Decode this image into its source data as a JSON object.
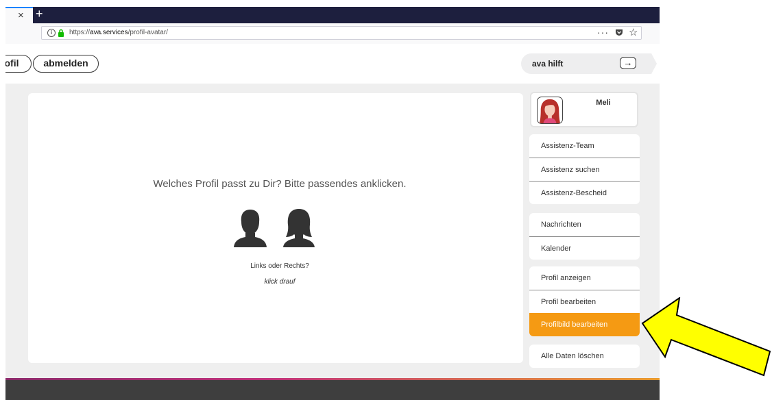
{
  "browser": {
    "tab_close": "×",
    "tab_new": "+",
    "url_prefix": "https://",
    "url_host": "ava.services",
    "url_path": "/profil-avatar/",
    "more_label": "···",
    "star_label": "☆"
  },
  "header": {
    "profil_button": "ofil",
    "logout_button": "abmelden",
    "help_label": "ava hilft",
    "help_arrow": "→"
  },
  "card": {
    "question": "Welches Profil passt zu Dir? Bitte passendes anklicken.",
    "hint": "Links oder Rechts?",
    "sub": "klick drauf"
  },
  "profile": {
    "name": "Meli"
  },
  "menu": {
    "group1": [
      "Assistenz-Team",
      "Assistenz suchen",
      "Assistenz-Bescheid"
    ],
    "group2": [
      "Nachrichten",
      "Kalender"
    ],
    "group3": [
      "Profil anzeigen",
      "Profil bearbeiten",
      "Profilbild bearbeiten"
    ],
    "group4": [
      "Alle Daten löschen"
    ]
  },
  "colors": {
    "accent": "#f59a13",
    "tabbar": "#1d1f3e",
    "annotation": "#ffff00"
  }
}
